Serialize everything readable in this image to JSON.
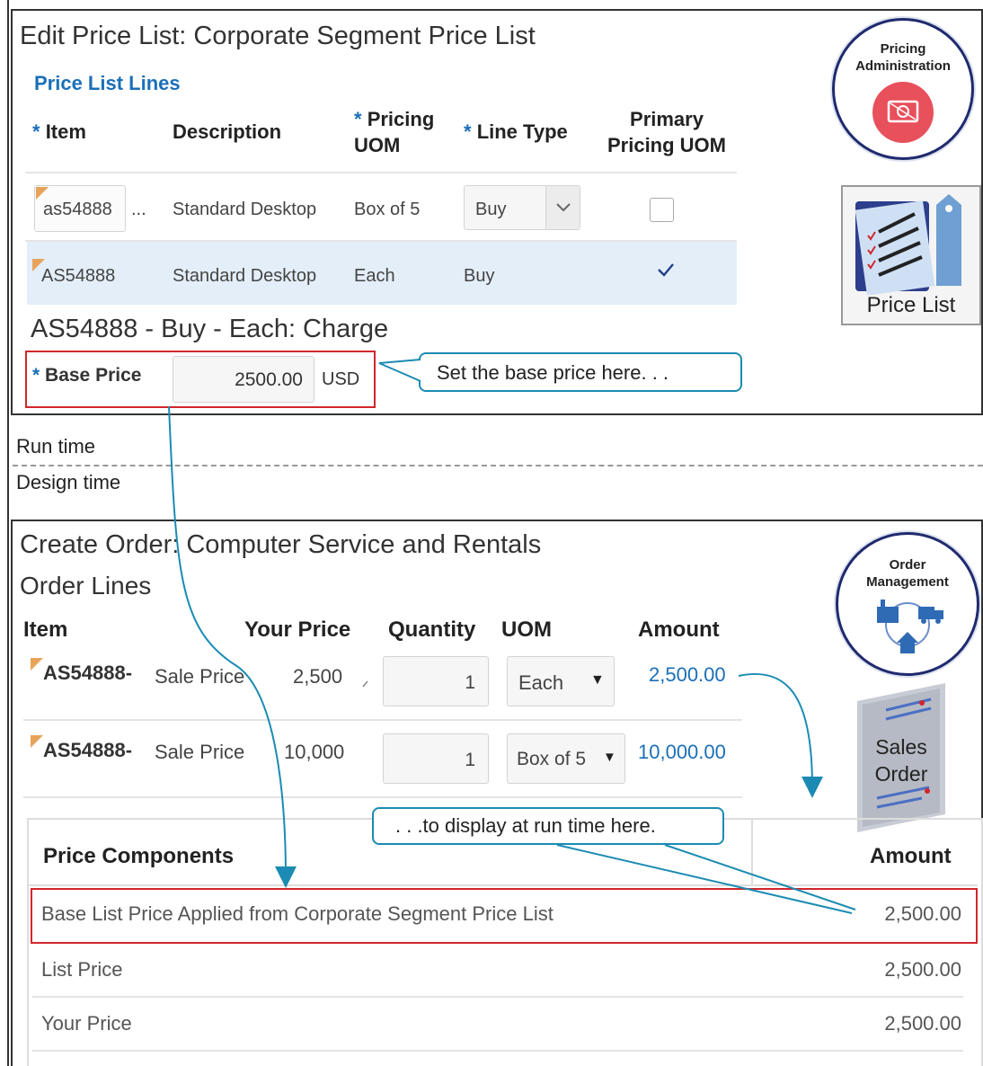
{
  "price_list_panel": {
    "title": "Edit Price List: Corporate Segment Price List",
    "section_title": "Price List Lines",
    "columns": {
      "item": "Item",
      "description": "Description",
      "pricing_uom_line1": "Pricing",
      "pricing_uom_line2": "UOM",
      "line_type": "Line Type",
      "primary_line1": "Primary",
      "primary_line2": "Pricing UOM"
    },
    "required_marker": "*",
    "rows": [
      {
        "item": "as54888",
        "ellipsis": "...",
        "description": "Standard Desktop",
        "pricing_uom": "Box of 5",
        "line_type": "Buy",
        "primary": false
      },
      {
        "item": "AS54888",
        "description": "Standard Desktop",
        "pricing_uom": "Each",
        "line_type": "Buy",
        "primary": true
      }
    ],
    "charge_title": "AS54888 - Buy - Each: Charge",
    "base_price_label": "Base Price",
    "base_price_value": "2500.00",
    "currency": "USD",
    "callout": "Set the base price here. . ."
  },
  "pricing_admin_badge": {
    "line1": "Pricing",
    "line2": "Administration",
    "icon": "price-tag-icon"
  },
  "price_list_badge": {
    "label": "Price List",
    "icon": "price-list-document-icon"
  },
  "separator": {
    "run_time": "Run time",
    "design_time": "Design time"
  },
  "order_panel": {
    "title": "Create Order: Computer Service and Rentals",
    "section_title": "Order Lines",
    "columns": {
      "item": "Item",
      "your_price": "Your Price",
      "quantity": "Quantity",
      "uom": "UOM",
      "amount": "Amount"
    },
    "rows": [
      {
        "item": "AS54888-",
        "price_type": "Sale Price",
        "your_price": "2,500",
        "quantity": "1",
        "uom": "Each",
        "amount": "2,500.00"
      },
      {
        "item": "AS54888-",
        "price_type": "Sale Price",
        "your_price": "10,000",
        "quantity": "1",
        "uom": "Box of 5",
        "amount": "10,000.00"
      }
    ],
    "callout": ". . .to display at run time here.",
    "price_components": {
      "header": "Price Components",
      "amount_header": "Amount",
      "rows": [
        {
          "label": "Base List Price Applied from Corporate Segment Price List",
          "amount": "2,500.00"
        },
        {
          "label": "List Price",
          "amount": "2,500.00"
        },
        {
          "label": "Your Price",
          "amount": "2,500.00"
        }
      ]
    }
  },
  "order_mgmt_badge": {
    "line1": "Order",
    "line2": "Management",
    "icon": "order-management-network-icon"
  },
  "sales_order_badge": {
    "line1": "Sales",
    "line2": "Order",
    "icon": "sales-order-document-icon"
  },
  "colors": {
    "accent_blue": "#1b6fb8",
    "callout_teal": "#1b8bb3",
    "highlight_red": "#d2262c",
    "badge_navy": "#1f2a6e",
    "flag_orange": "#e8a35a"
  }
}
